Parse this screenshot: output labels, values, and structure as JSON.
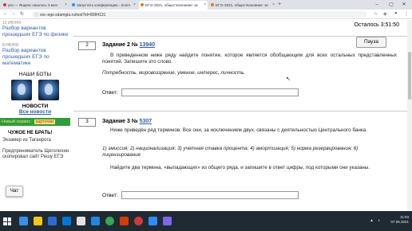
{
  "browser": {
    "tabs": [
      {
        "label": "ysn — Яндекс нашлось 3 млн",
        "color": "#d23a3a"
      },
      {
        "label": "Запустить конференцию - Zoom",
        "color": "#2d8cff"
      },
      {
        "label": "ЕГЭ–2021, обществознание: за",
        "color": "#e07b1a"
      },
      {
        "label": "ЕГЭ–2021, обществознание: за",
        "color": "#e07b1a"
      }
    ],
    "new_tab": "+",
    "url": "soc-ege.sdamgia.ru/test?id=8084131"
  },
  "sidebar": {
    "entries": [
      {
        "date": "12 ИЮНЯ",
        "link": "Разбор вариантов прошедших ЕГЭ по физике"
      },
      {
        "date": "8 ИЮНЯ",
        "link": "Разбор вариантов прошедших ЕГЭ по математике"
      }
    ],
    "bots_heading": "НАШИ БОТЫ",
    "news_heading": "НОВОСТИ",
    "all_news": "Все новости",
    "promo_text": "Новый сервис:",
    "promo_card": "карточки",
    "warn_heading": "ЧУЖОЕ НЕ БРАТЬ!",
    "story_line1": "Экзамер из Таганрога",
    "story_line2": "Предприниматель Щеголихин скопировал сайт Решу ЕГЭ",
    "chat_label": "Чат"
  },
  "main": {
    "timer": "Осталось 3:51:50",
    "pause_label": "Пауза",
    "tasks": [
      {
        "number": "2",
        "title_prefix": "Задание 2 №",
        "title_link": "13940",
        "body": "В приведенном ниже ряду найдите понятие, которое является обобщающим для всех остальных представленных понятий. Запишите это слово.",
        "items": "Потребность, мировоззрение, умение, интерес, личность.",
        "answer_label": "Ответ:",
        "answer_value": ""
      },
      {
        "number": "3",
        "title_prefix": "Задание 3 №",
        "title_link": "5307",
        "body": "Ниже приведён ряд терминов. Все они, за исключением двух, связаны с деятельностью Центрального банка.",
        "items": "1) эмиссия; 2) национализация; 3) учетная ставка процента; 4) амортизация; 5) норма резервирования; 6) лицензирование",
        "instruction": "Найдите два термина, «выпадающих» из общего ряда, и запишите в ответ цифры, под которыми они указаны.",
        "answer_label": "Ответ:",
        "answer_value": ""
      }
    ]
  },
  "taskbar": {
    "time": "11:03",
    "date": "07.06.2021",
    "icons": [
      "start-icon",
      "search-icon",
      "task-view-icon",
      "edge-icon",
      "explorer-icon",
      "store-icon",
      "mail-icon",
      "chrome-icon",
      "office-icon",
      "yandex-icon",
      "zoom-icon",
      "app-icon"
    ],
    "icon_colors": [
      "#3a8ee6",
      "#f5c518",
      "#2b6bd6",
      "#0078d7",
      "#e0e0e0",
      "#1e88e5",
      "#34a853",
      "#d83b01",
      "#d23a3a",
      "#2d8cff",
      "#7b68ee"
    ]
  }
}
